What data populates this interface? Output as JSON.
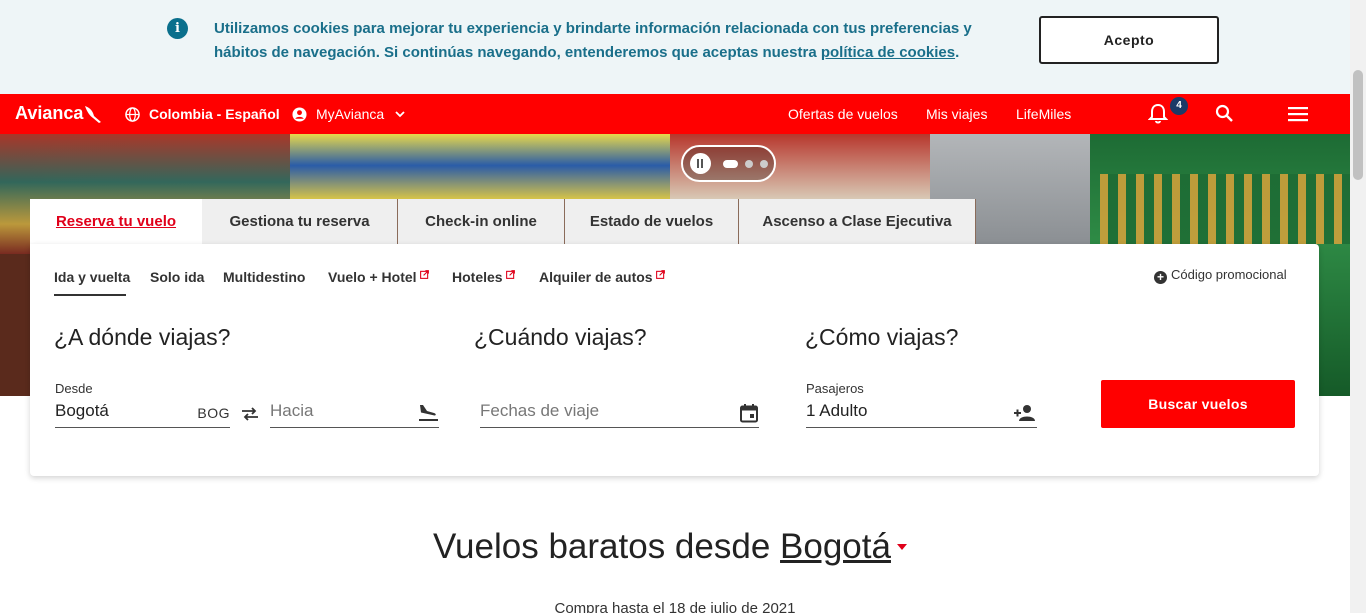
{
  "cookie_banner": {
    "message": "Utilizamos cookies para mejorar tu experiencia y brindarte información relacionada con tus preferencias y hábitos de navegación. Si continúas navegando, entenderemos que aceptas nuestra",
    "link_text": "política de cookies",
    "suffix": ".",
    "accept_label": "Acepto"
  },
  "navbar": {
    "logo": "Avianca",
    "country_lang": "Colombia - Español",
    "myavianca": "MyAvianca",
    "links": [
      "Ofertas de vuelos",
      "Mis viajes",
      "LifeMiles"
    ],
    "notifications_count": "4"
  },
  "tabs": [
    "Reserva tu vuelo",
    "Gestiona tu reserva",
    "Check-in online",
    "Estado de vuelos",
    "Ascenso a Clase Ejecutiva"
  ],
  "subtabs": [
    "Ida y vuelta",
    "Solo ida",
    "Multidestino",
    "Vuelo + Hotel",
    "Hoteles",
    "Alquiler de autos"
  ],
  "promo_code": "Código promocional",
  "sections": {
    "where": "¿A dónde viajas?",
    "when": "¿Cuándo viajas?",
    "how": "¿Cómo viajas?"
  },
  "form": {
    "from_label": "Desde",
    "from_value": "Bogotá",
    "from_code": "BOG",
    "to_placeholder": "Hacia",
    "dates_placeholder": "Fechas de viaje",
    "passengers_label": "Pasajeros",
    "passengers_value": "1 Adulto",
    "search_label": "Buscar vuelos"
  },
  "deals": {
    "title_prefix": "Vuelos baratos desde",
    "city": "Bogotá",
    "subtitle": "Compra hasta el 18 de julio de 2021"
  },
  "colors": {
    "brand_red": "#ff0000",
    "cookie_text": "#1a6f8a",
    "badge": "#1c3a67"
  }
}
